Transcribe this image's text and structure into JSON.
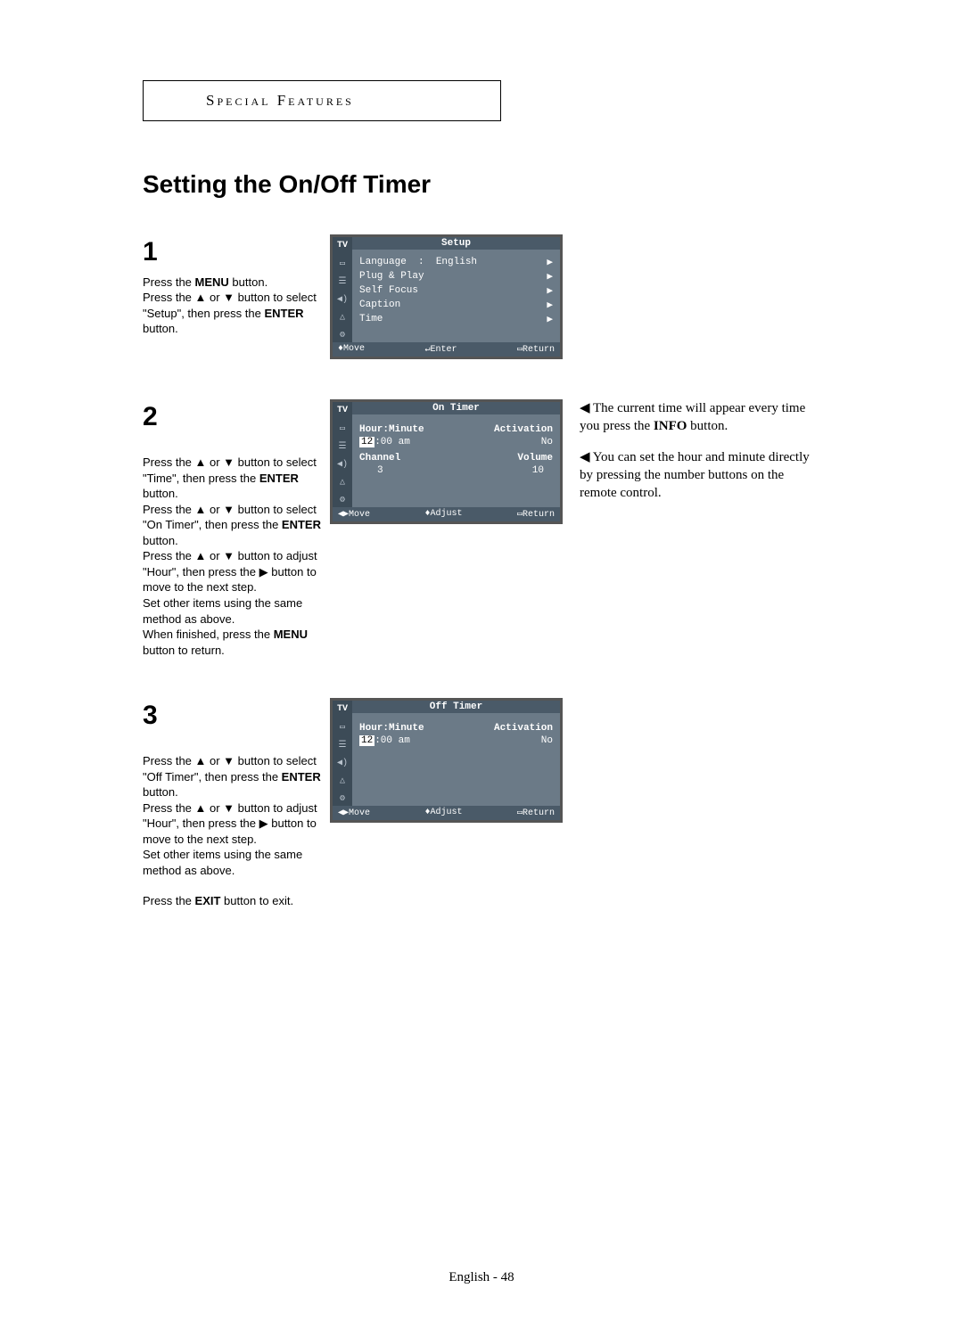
{
  "header": {
    "section": "Special Features"
  },
  "title": "Setting the On/Off Timer",
  "steps": {
    "s1": {
      "num": "1",
      "text_parts": [
        "Press the ",
        "MENU",
        " button.\nPress the ▲ or ▼ button to select \"Setup\", then press the ",
        "ENTER",
        " button."
      ]
    },
    "s2": {
      "num": "2",
      "text_parts": [
        "Press the ▲ or ▼ button to select \"Time\", then press the ",
        "ENTER",
        " button.\nPress the ▲ or ▼ button to select \"On Timer\", then press the ",
        "ENTER",
        " button.\nPress the ▲ or ▼ button to adjust \"Hour\", then press the ▶ button to move to the next step.\nSet other items using the same method as above.\nWhen finished, press the ",
        "MENU",
        " button to return."
      ]
    },
    "s3": {
      "num": "3",
      "text_parts": [
        "Press the ▲ or ▼ button to select \"Off Timer\", then press the ",
        "ENTER",
        " button.\nPress the ▲ or ▼ button to adjust \"Hour\", then press the ▶ button to move to the next step.\nSet other items using the same method as above."
      ],
      "after": [
        "Press the ",
        "EXIT",
        " button to exit."
      ]
    }
  },
  "screens": {
    "s1": {
      "title": "Setup",
      "items": [
        {
          "label": "Language",
          "sep": ":",
          "value": "English",
          "arrow": "▶"
        },
        {
          "label": "Plug & Play",
          "arrow": "▶"
        },
        {
          "label": "Self Focus",
          "arrow": "▶"
        },
        {
          "label": "Caption",
          "arrow": "▶"
        },
        {
          "label": "Time",
          "arrow": "▶"
        }
      ],
      "footer": {
        "l": "♦Move",
        "c": "↵Enter",
        "r": "▭Return"
      }
    },
    "s2": {
      "title": "On Timer",
      "rowA": {
        "l": "Hour:Minute",
        "r": "Activation"
      },
      "valA": {
        "l_hl": "12",
        "l_rest": ":00 am",
        "r": "No"
      },
      "rowB": {
        "l": "Channel",
        "r": "Volume"
      },
      "valB": {
        "l": "3",
        "r": "10"
      },
      "footer": {
        "l": "◀▶Move",
        "c": "♦Adjust",
        "r": "▭Return"
      }
    },
    "s3": {
      "title": "Off Timer",
      "rowA": {
        "l": "Hour:Minute",
        "r": "Activation"
      },
      "valA": {
        "l_hl": "12",
        "l_rest": ":00 am",
        "r": "No"
      },
      "footer": {
        "l": "◀▶Move",
        "c": "♦Adjust",
        "r": "▭Return"
      }
    },
    "tv_label": "TV"
  },
  "notes": {
    "n1_parts": [
      "◀ The current time will appear every time you press the ",
      "INFO",
      " button."
    ],
    "n2": "◀ You can set the hour and minute directly by pressing the number buttons on the remote control."
  },
  "footer": "English - 48"
}
